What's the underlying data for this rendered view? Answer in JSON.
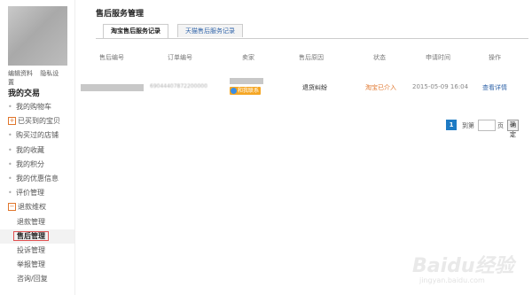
{
  "sidebar": {
    "profile_links": [
      "编辑资料",
      "隐私设置"
    ],
    "section_title": "我的交易",
    "items": [
      {
        "label": "我的购物车",
        "marker": "•"
      },
      {
        "label": "已买到的宝贝",
        "marker": "⊞"
      },
      {
        "label": "购买过的店铺",
        "marker": "•"
      },
      {
        "label": "我的收藏",
        "marker": "•"
      },
      {
        "label": "我的积分",
        "marker": "•"
      },
      {
        "label": "我的优惠信息",
        "marker": "•"
      },
      {
        "label": "评价管理",
        "marker": "•"
      },
      {
        "label": "退款维权",
        "marker": "⊟"
      },
      {
        "label": "退款管理",
        "marker": ""
      },
      {
        "label": "售后管理",
        "marker": ""
      },
      {
        "label": "投诉管理",
        "marker": ""
      },
      {
        "label": "举报管理",
        "marker": ""
      },
      {
        "label": "咨询/回复",
        "marker": ""
      }
    ]
  },
  "main": {
    "title": "售后服务管理",
    "tabs": [
      {
        "label": "淘宝售后服务记录",
        "active": true
      },
      {
        "label": "天猫售后服务记录",
        "active": false
      }
    ],
    "columns": [
      "售后编号",
      "订单编号",
      "卖家",
      "售后原因",
      "状态",
      "申请时间",
      "操作"
    ],
    "rows": [
      {
        "order_no": "69044407872200000",
        "seller_contact": "和我联系",
        "reason": "退货纠纷",
        "status": "淘宝已介入",
        "time": "2015-05-09 16:04",
        "action": "查看详情"
      }
    ],
    "pager": {
      "current": "1",
      "goto_label": "到第",
      "page_unit": "页",
      "confirm_label": "确定"
    }
  },
  "colors": {
    "accent": "#1e7bc4",
    "status": "#e0762c",
    "link": "#3366aa"
  },
  "watermark": {
    "text": "Baidu经验",
    "sub": "jingyan.baidu.com"
  }
}
